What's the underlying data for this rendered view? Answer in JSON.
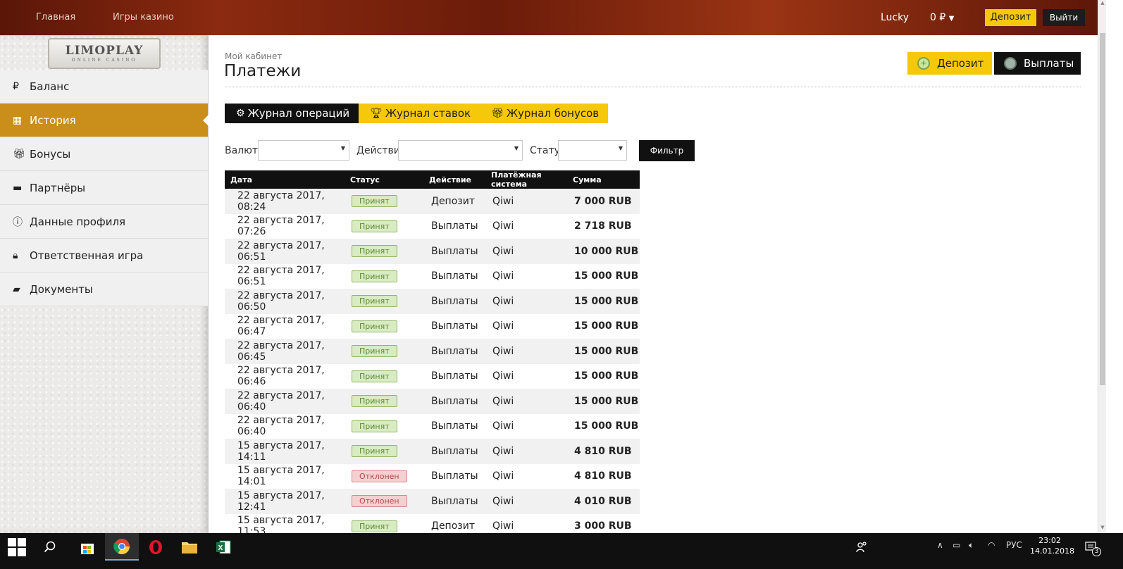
{
  "topbar": {
    "nav": [
      "Главная",
      "Игры казино"
    ],
    "username": "Lucky",
    "balance": "0 ₽",
    "deposit_label": "Депозит",
    "logout_label": "Выйти"
  },
  "logo": {
    "line1": "LIMOPLAY",
    "line2": "ONLINE CASINO"
  },
  "sidebar": {
    "items": [
      {
        "label": "Баланс",
        "icon": "ruble-icon"
      },
      {
        "label": "История",
        "icon": "calendar-icon",
        "active": true
      },
      {
        "label": "Бонусы",
        "icon": "gift-icon"
      },
      {
        "label": "Партнёры",
        "icon": "briefcase-icon"
      },
      {
        "label": "Данные профиля",
        "icon": "info-icon"
      },
      {
        "label": "Ответственная игра",
        "icon": "lock-icon"
      },
      {
        "label": "Документы",
        "icon": "folder-icon"
      }
    ]
  },
  "page": {
    "breadcrumb": "Мой кабинет",
    "title": "Платежи",
    "deposit_label": "Депозит",
    "payout_label": "Выплаты"
  },
  "tabs": [
    {
      "label": "Журнал операций",
      "icon": "gear-icon",
      "active": true
    },
    {
      "label": "Журнал ставок",
      "icon": "trophy-icon"
    },
    {
      "label": "Журнал бонусов",
      "icon": "gift-icon"
    }
  ],
  "filters": {
    "currency_label": "Валюта",
    "action_label": "Действие",
    "status_label": "Статус",
    "filter_button": "Фильтр"
  },
  "table": {
    "headers": [
      "Дата",
      "Статус",
      "Действие",
      "Платёжная система",
      "Сумма"
    ],
    "rows": [
      {
        "date": "22 августа 2017, 08:24",
        "status": "Принят",
        "ok": true,
        "action": "Депозит",
        "system": "Qiwi",
        "amount": "7 000 RUB"
      },
      {
        "date": "22 августа 2017, 07:26",
        "status": "Принят",
        "ok": true,
        "action": "Выплаты",
        "system": "Qiwi",
        "amount": "2 718 RUB"
      },
      {
        "date": "22 августа 2017, 06:51",
        "status": "Принят",
        "ok": true,
        "action": "Выплаты",
        "system": "Qiwi",
        "amount": "10 000 RUB"
      },
      {
        "date": "22 августа 2017, 06:51",
        "status": "Принят",
        "ok": true,
        "action": "Выплаты",
        "system": "Qiwi",
        "amount": "15 000 RUB"
      },
      {
        "date": "22 августа 2017, 06:50",
        "status": "Принят",
        "ok": true,
        "action": "Выплаты",
        "system": "Qiwi",
        "amount": "15 000 RUB"
      },
      {
        "date": "22 августа 2017, 06:47",
        "status": "Принят",
        "ok": true,
        "action": "Выплаты",
        "system": "Qiwi",
        "amount": "15 000 RUB"
      },
      {
        "date": "22 августа 2017, 06:45",
        "status": "Принят",
        "ok": true,
        "action": "Выплаты",
        "system": "Qiwi",
        "amount": "15 000 RUB"
      },
      {
        "date": "22 августа 2017, 06:46",
        "status": "Принят",
        "ok": true,
        "action": "Выплаты",
        "system": "Qiwi",
        "amount": "15 000 RUB"
      },
      {
        "date": "22 августа 2017, 06:40",
        "status": "Принят",
        "ok": true,
        "action": "Выплаты",
        "system": "Qiwi",
        "amount": "15 000 RUB"
      },
      {
        "date": "22 августа 2017, 06:40",
        "status": "Принят",
        "ok": true,
        "action": "Выплаты",
        "system": "Qiwi",
        "amount": "15 000 RUB"
      },
      {
        "date": "15 августа 2017, 14:11",
        "status": "Принят",
        "ok": true,
        "action": "Выплаты",
        "system": "Qiwi",
        "amount": "4 810 RUB"
      },
      {
        "date": "15 августа 2017, 14:01",
        "status": "Отклонен",
        "ok": false,
        "action": "Выплаты",
        "system": "Qiwi",
        "amount": "4 810 RUB"
      },
      {
        "date": "15 августа 2017, 12:41",
        "status": "Отклонен",
        "ok": false,
        "action": "Выплаты",
        "system": "Qiwi",
        "amount": "4 010 RUB"
      },
      {
        "date": "15 августа 2017, 11:53",
        "status": "Принят",
        "ok": true,
        "action": "Депозит",
        "system": "Qiwi",
        "amount": "3 000 RUB"
      }
    ]
  },
  "taskbar": {
    "lang": "РУС",
    "time": "23:02",
    "date": "14.01.2018",
    "notifications": "3"
  },
  "colors": {
    "accent": "#f5c80a",
    "active_nav": "#c98f1a",
    "dark": "#111111"
  }
}
